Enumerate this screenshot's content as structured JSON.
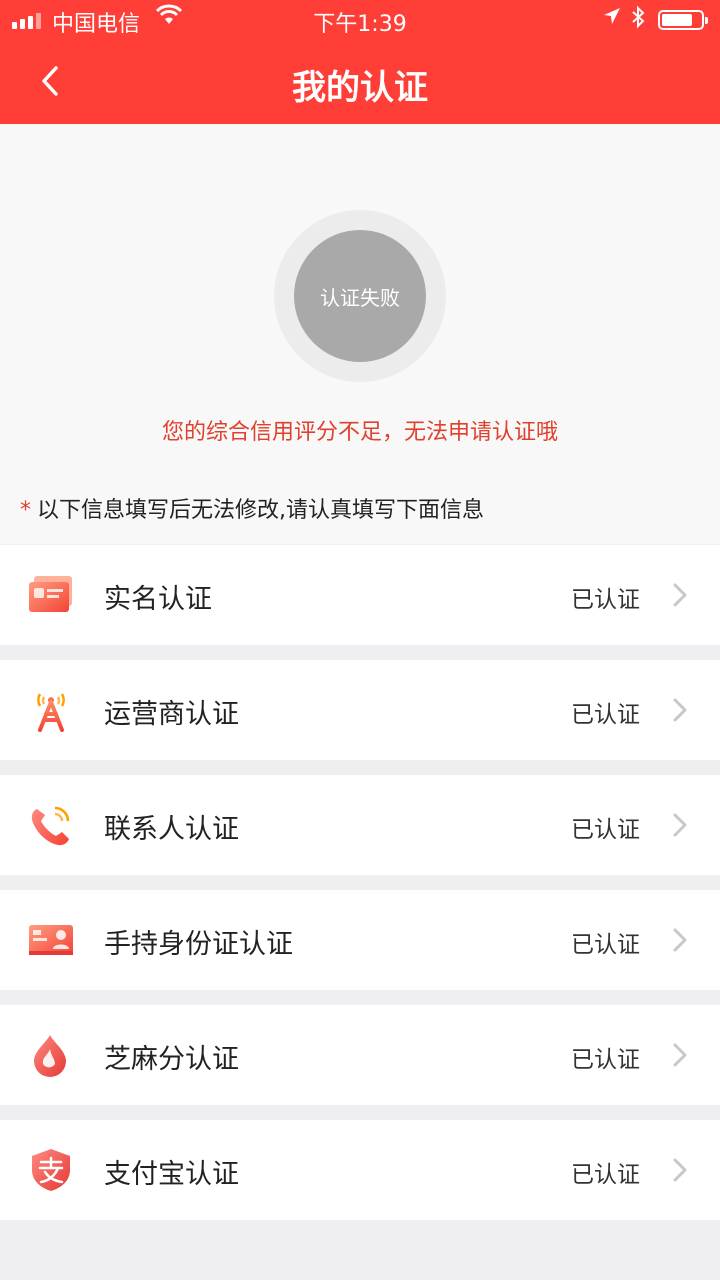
{
  "status_bar": {
    "carrier": "中国电信",
    "time": "下午1:39"
  },
  "nav": {
    "title": "我的认证",
    "back_icon": "chevron-left-icon"
  },
  "badge": {
    "text": "认证失败",
    "color": "#a9a9a9"
  },
  "fail_message": "您的综合信用评分不足，无法申请认证哦",
  "note": {
    "star": "*",
    "text": "以下信息填写后无法修改,请认真填写下面信息"
  },
  "colors": {
    "brand": "#fe3e37",
    "warning_text": "#e0402d",
    "icon_gradient_start": "#ff8a80",
    "icon_gradient_end": "#f44336"
  },
  "items": [
    {
      "label": "实名认证",
      "status": "已认证",
      "icon": "id-card-icon"
    },
    {
      "label": "运营商认证",
      "status": "已认证",
      "icon": "signal-tower-icon"
    },
    {
      "label": "联系人认证",
      "status": "已认证",
      "icon": "phone-icon"
    },
    {
      "label": "手持身份证认证",
      "status": "已认证",
      "icon": "id-photo-icon"
    },
    {
      "label": "芝麻分认证",
      "status": "已认证",
      "icon": "sesame-drop-icon"
    },
    {
      "label": "支付宝认证",
      "status": "已认证",
      "icon": "alipay-shield-icon"
    }
  ]
}
